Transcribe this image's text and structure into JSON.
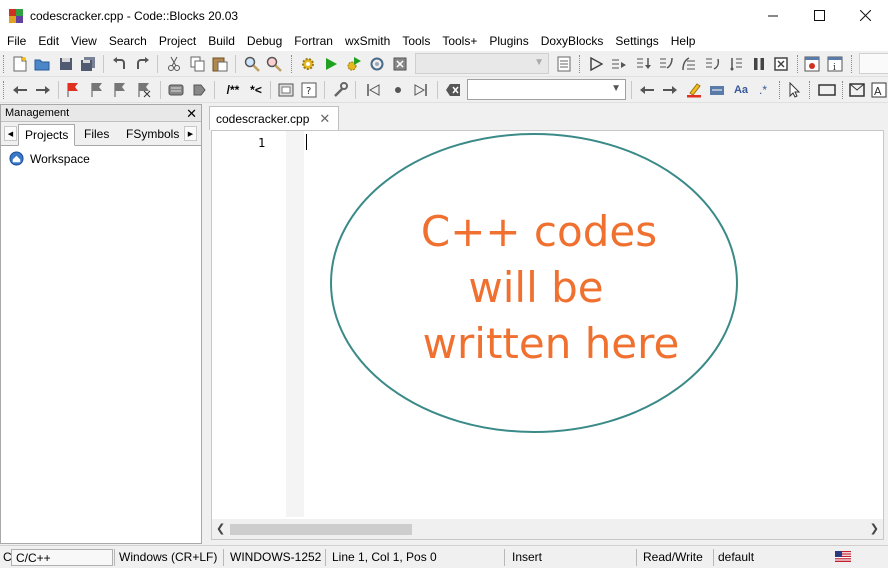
{
  "window": {
    "title": "codescracker.cpp - Code::Blocks 20.03"
  },
  "menu": [
    "File",
    "Edit",
    "View",
    "Search",
    "Project",
    "Build",
    "Debug",
    "Fortran",
    "wxSmith",
    "Tools",
    "Tools+",
    "Plugins",
    "DoxyBlocks",
    "Settings",
    "Help"
  ],
  "toolbar2": {
    "doxy_block": "/**",
    "doxy_line": "*<"
  },
  "management": {
    "title": "Management",
    "tabs": [
      "Projects",
      "Files",
      "FSymbols"
    ],
    "active_tab": "Projects",
    "tree_root": "Workspace"
  },
  "editor": {
    "tab_label": "codescracker.cpp",
    "line_numbers": [
      "1"
    ],
    "annotation_lines": [
      "C++ codes",
      "will be",
      "written here"
    ],
    "annotation_text_color": "#f07030",
    "annotation_ellipse_color": "#3a8a88"
  },
  "status": {
    "language_prefix": "C",
    "language": "C/C++",
    "line_endings": "Windows (CR+LF)",
    "encoding": "WINDOWS-1252",
    "position": "Line 1, Col 1, Pos 0",
    "insert_mode": "Insert",
    "access": "Read/Write",
    "profile": "default"
  }
}
